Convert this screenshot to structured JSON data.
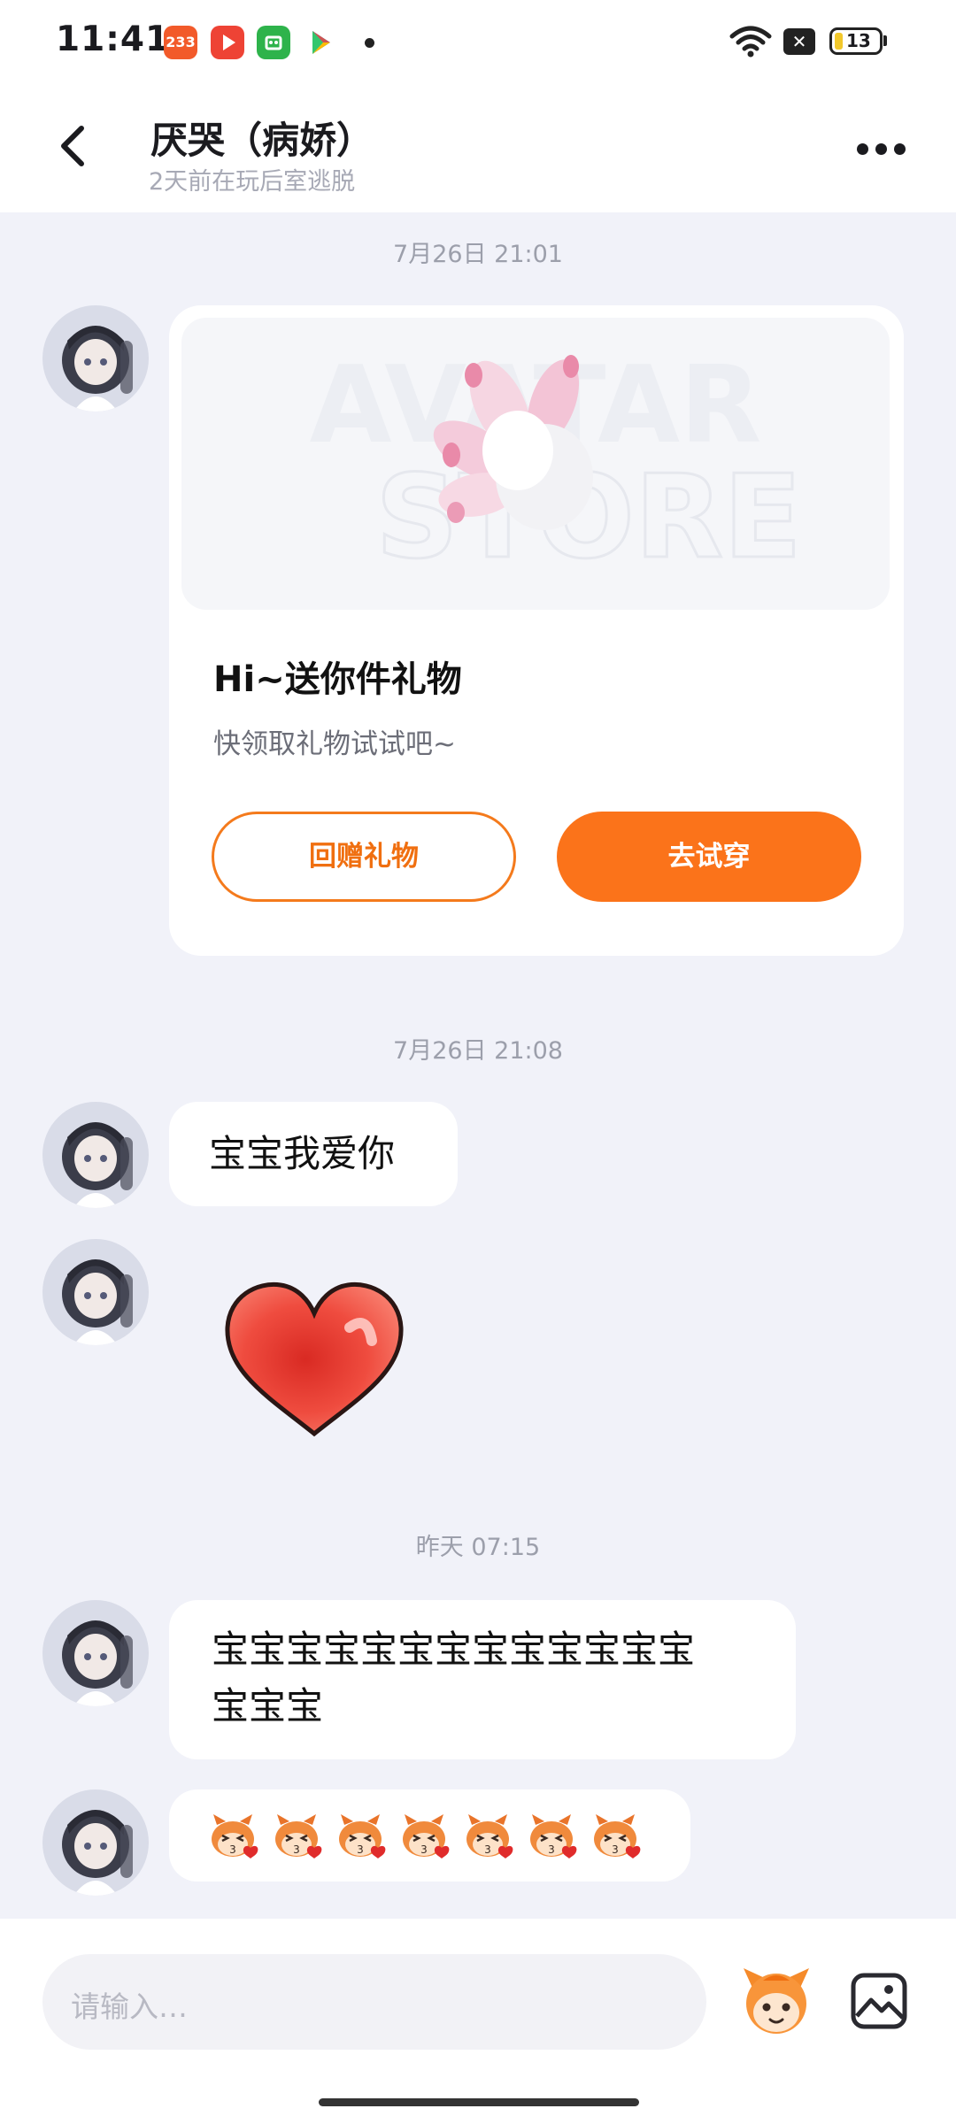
{
  "status_bar": {
    "time": "11:41",
    "app_icons": [
      {
        "name": "233-app-icon",
        "label": "233",
        "color": "#f25a2a"
      },
      {
        "name": "video-app-icon",
        "label": "",
        "color": "#ee4335"
      },
      {
        "name": "wechat-app-icon",
        "label": "",
        "color": "#2eb34b"
      },
      {
        "name": "play-store-icon",
        "label": "",
        "color": "#ffffff"
      }
    ],
    "battery": "13"
  },
  "header": {
    "back_icon": "chevron-left-icon",
    "title": "厌哭（病娇）",
    "subtitle": "2天前在玩后室逃脱",
    "more_icon": "more-horizontal-icon"
  },
  "messages": {
    "t1": "7月26日 21:01",
    "gift": {
      "banner_text_top": "AVATAR",
      "banner_text_bottom": "STORE",
      "title": "Hi~送你件礼物",
      "subtitle": "快领取礼物试试吧~",
      "return_label": "回赠礼物",
      "try_label": "去试穿"
    },
    "t2": "7月26日 21:08",
    "m1": "宝宝我爱你",
    "heart": "heart-sticker",
    "t3": "昨天 07:15",
    "m2_line1": "宝宝宝宝宝宝宝宝宝宝宝宝宝",
    "m2_line2": "宝宝宝",
    "sticker_count": 7
  },
  "input_bar": {
    "placeholder": "请输入…",
    "emoji_icon": "mascot-emoji-icon",
    "image_icon": "image-icon"
  },
  "colors": {
    "accent": "#fb731a",
    "background": "#f1f2f9"
  }
}
